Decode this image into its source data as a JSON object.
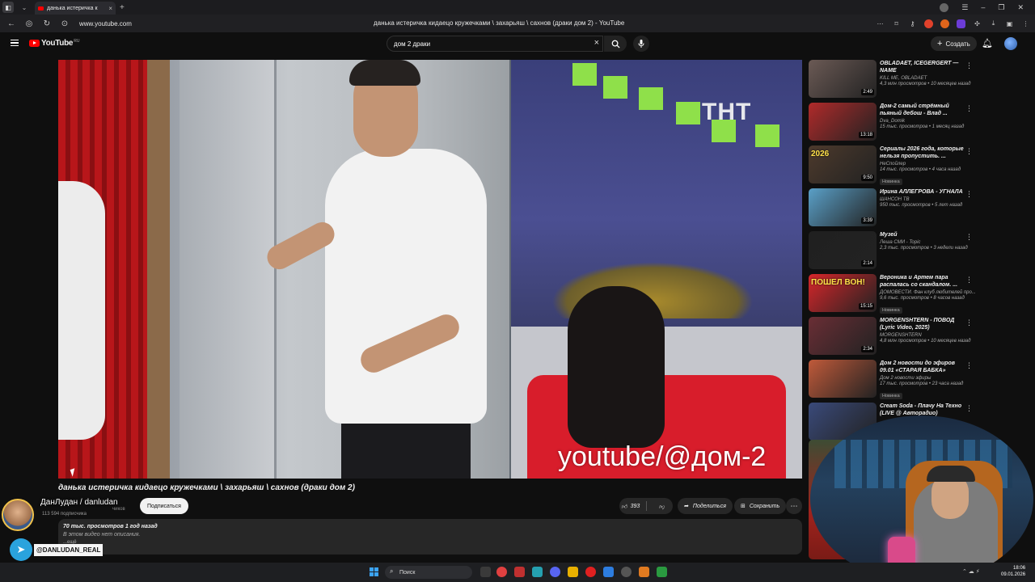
{
  "browser": {
    "tab_title": "данька истеричка к",
    "url": "www.youtube.com",
    "page_title": "данька истеричка кидаецо кружечками \\ захарьяш \\ сахнов (драки дом 2) - YouTube"
  },
  "header": {
    "logo_text": "YouTube",
    "logo_region": "RU",
    "search_value": "дом 2 драки",
    "create_label": "Создать"
  },
  "player": {
    "watermark": "youtube/@дом-2",
    "channel_logo": "ТНТ"
  },
  "video": {
    "title": "данька истеричка кидаецо кружечками \\ захарьяш \\ сахнов (драки дом 2)",
    "subscribers_fragment": "чиков",
    "subscribe_label": "Подписаться",
    "likes": "393",
    "share_label": "Поделиться",
    "save_label": "Сохранить",
    "stats": "70 тыс. просмотров  1 год назад",
    "description": "В этом видео нет описания.",
    "more_label": "...ещё"
  },
  "overlay": {
    "streamer_name": "ДанЛудан / danludan",
    "streamer_subs": "113 594 подписчика",
    "telegram_handle": "@DANLUDAN_REAL"
  },
  "recommendations": [
    {
      "title": "OBLADAET, ICEGERGERT — NAME",
      "channel": "KILL ME, OBLADAET",
      "stats": "4,3 млн просмотров • 10 месяцев назад",
      "duration": "2:49",
      "badge": "",
      "thumb_text": "",
      "color": "#6b5a55"
    },
    {
      "title": "Дом-2 самый стрёмный пьяный дебош - Влад ...",
      "channel": "Dva_Domik",
      "stats": "15 тыс. просмотров • 1 месяц назад",
      "duration": "13:18",
      "badge": "",
      "thumb_text": "",
      "color": "#b02a2a"
    },
    {
      "title": "Сериалы 2026 года, которые нельзя пропустить. ...",
      "channel": "НеСпойлер",
      "stats": "14 тыс. просмотров • 4 часа назад",
      "duration": "9:50",
      "badge": "Новинка",
      "thumb_text": "2026",
      "color": "#4d3a2c"
    },
    {
      "title": "Ирина АЛЛЕГРОВА - УГНАЛА",
      "channel": "ШАНСОН ТВ",
      "stats": "950 тыс. просмотров • 5 лет назад",
      "duration": "3:39",
      "badge": "",
      "thumb_text": "",
      "color": "#5aa0c8"
    },
    {
      "title": "Музей",
      "channel": "Леша СМИ - Topic",
      "stats": "2,3 тыс. просмотров • 3 недели назад",
      "duration": "2:14",
      "badge": "",
      "thumb_text": "",
      "color": "#202020"
    },
    {
      "title": "Вероника и Артем пара распалась со скандалом. ...",
      "channel": "ДОМОВЕСТИ. Фан клуб любителей про...",
      "stats": "9,6 тыс. просмотров • 8 часов назад",
      "duration": "15:15",
      "badge": "Новинка",
      "thumb_text": "ПОШЕЛ ВОН!",
      "color": "#d7262a"
    },
    {
      "title": "MORGENSHTERN - ПОВОД (Lyric Video, 2025)",
      "channel": "MORGENSHTERN",
      "stats": "4,8 млн просмотров • 10 месяцев назад",
      "duration": "2:34",
      "badge": "",
      "thumb_text": "",
      "color": "#6a2e35"
    },
    {
      "title": "Дом 2 новости до эфиров 09.01 «СТАРАЯ БАБКА»",
      "channel": "Дом 2 новости эфиры",
      "stats": "17 тыс. просмотров • 23 часа назад",
      "duration": "",
      "badge": "Новинка",
      "thumb_text": "",
      "color": "#c05a3a"
    },
    {
      "title": "Cream Soda - Плачу На Техно (LIVE @ Авторадио)",
      "channel": "",
      "stats": "",
      "duration": "",
      "badge": "",
      "thumb_text": "",
      "color": "#3a4a7a"
    }
  ],
  "taskbar": {
    "search_label": "Поиск",
    "time": "18:06",
    "date": "09.01.2026"
  }
}
